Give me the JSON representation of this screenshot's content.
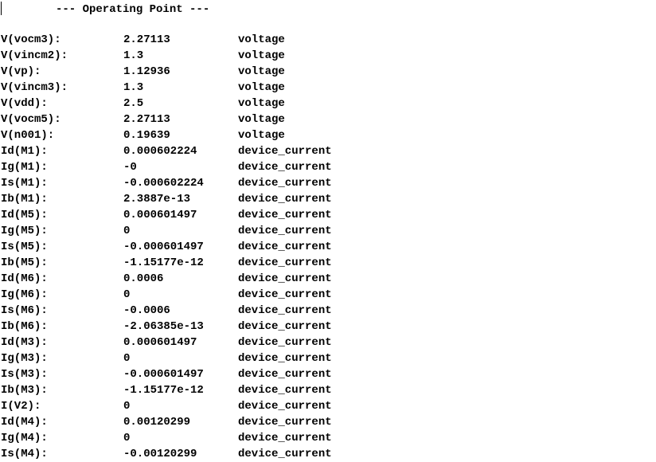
{
  "header": "--- Operating Point ---",
  "rows": [
    {
      "name": "V(vocm3):",
      "value": "2.27113",
      "type": "voltage"
    },
    {
      "name": "V(vincm2):",
      "value": "1.3",
      "type": "voltage"
    },
    {
      "name": "V(vp):",
      "value": "1.12936",
      "type": "voltage"
    },
    {
      "name": "V(vincm3):",
      "value": "1.3",
      "type": "voltage"
    },
    {
      "name": "V(vdd):",
      "value": "2.5",
      "type": "voltage"
    },
    {
      "name": "V(vocm5):",
      "value": "2.27113",
      "type": "voltage"
    },
    {
      "name": "V(n001):",
      "value": "0.19639",
      "type": "voltage"
    },
    {
      "name": "Id(M1):",
      "value": "0.000602224",
      "type": "device_current"
    },
    {
      "name": "Ig(M1):",
      "value": "-0",
      "type": "device_current"
    },
    {
      "name": "Is(M1):",
      "value": "-0.000602224",
      "type": "device_current"
    },
    {
      "name": "Ib(M1):",
      "value": "2.3887e-13",
      "type": "device_current"
    },
    {
      "name": "Id(M5):",
      "value": "0.000601497",
      "type": "device_current"
    },
    {
      "name": "Ig(M5):",
      "value": "0",
      "type": "device_current"
    },
    {
      "name": "Is(M5):",
      "value": "-0.000601497",
      "type": "device_current"
    },
    {
      "name": "Ib(M5):",
      "value": "-1.15177e-12",
      "type": "device_current"
    },
    {
      "name": "Id(M6):",
      "value": "0.0006",
      "type": "device_current"
    },
    {
      "name": "Ig(M6):",
      "value": "0",
      "type": "device_current"
    },
    {
      "name": "Is(M6):",
      "value": "-0.0006",
      "type": "device_current"
    },
    {
      "name": "Ib(M6):",
      "value": "-2.06385e-13",
      "type": "device_current"
    },
    {
      "name": "Id(M3):",
      "value": "0.000601497",
      "type": "device_current"
    },
    {
      "name": "Ig(M3):",
      "value": "0",
      "type": "device_current"
    },
    {
      "name": "Is(M3):",
      "value": "-0.000601497",
      "type": "device_current"
    },
    {
      "name": "Ib(M3):",
      "value": "-1.15177e-12",
      "type": "device_current"
    },
    {
      "name": "I(V2):",
      "value": "0",
      "type": "device_current"
    },
    {
      "name": "Id(M4):",
      "value": "0.00120299",
      "type": "device_current"
    },
    {
      "name": "Ig(M4):",
      "value": "0",
      "type": "device_current"
    },
    {
      "name": "Is(M4):",
      "value": "-0.00120299",
      "type": "device_current"
    }
  ]
}
